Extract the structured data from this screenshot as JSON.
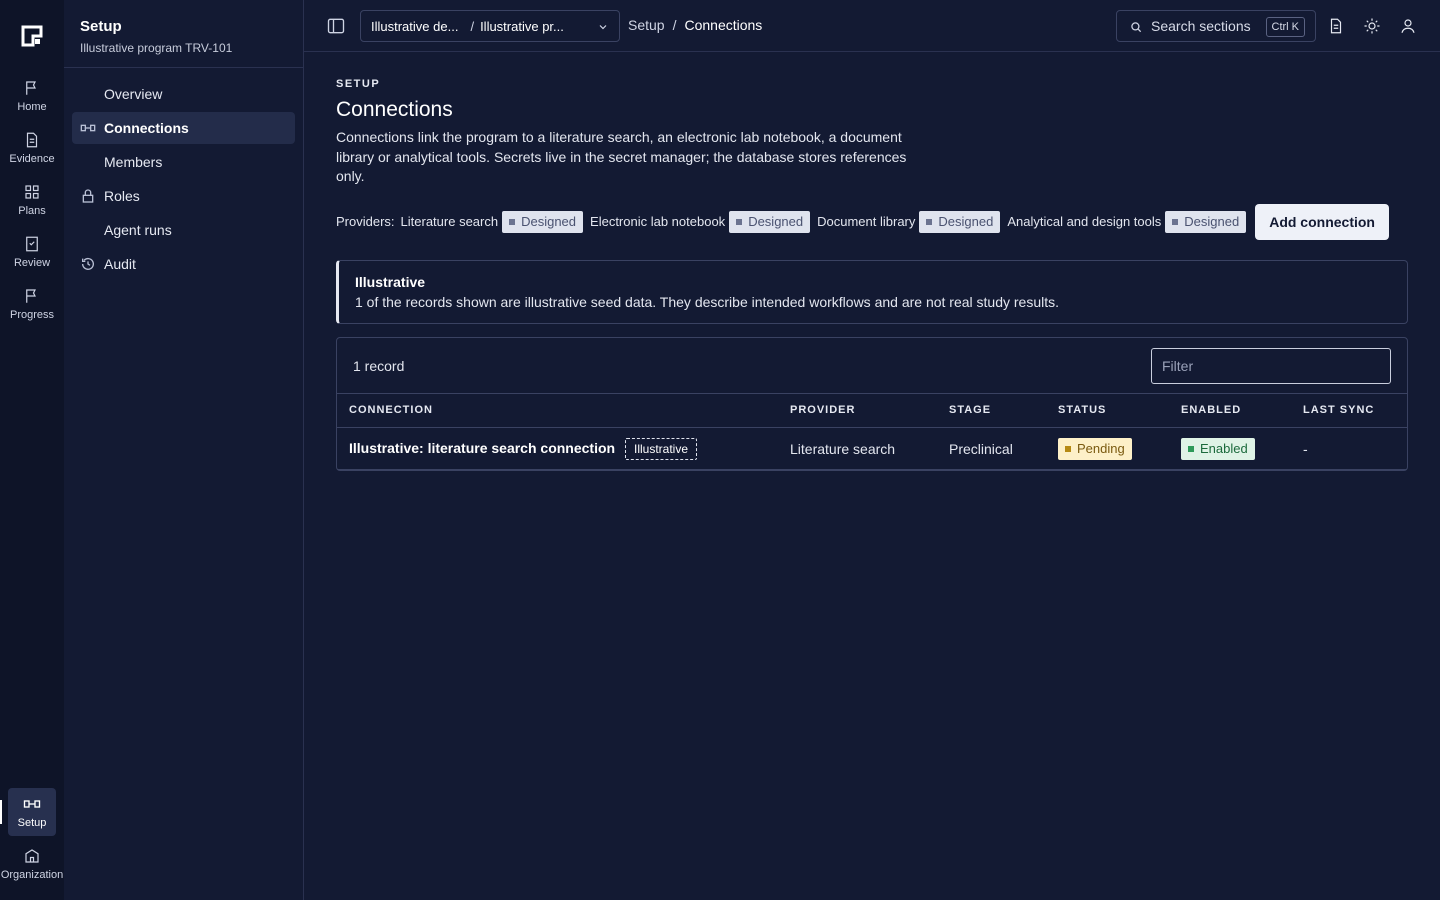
{
  "rail": {
    "items": [
      {
        "label": "Home",
        "icon": "flag-icon"
      },
      {
        "label": "Evidence",
        "icon": "document-icon"
      },
      {
        "label": "Plans",
        "icon": "grid-icon"
      },
      {
        "label": "Review",
        "icon": "checklist-icon"
      },
      {
        "label": "Progress",
        "icon": "flag-icon"
      }
    ],
    "bottom_items": [
      {
        "label": "Setup",
        "icon": "connection-icon",
        "active": true
      },
      {
        "label": "Organization",
        "icon": "building-icon"
      }
    ]
  },
  "subnav": {
    "title": "Setup",
    "subtitle": "Illustrative program TRV-101",
    "items": [
      {
        "label": "Overview"
      },
      {
        "label": "Connections",
        "icon": "connection-icon",
        "active": true
      },
      {
        "label": "Members"
      },
      {
        "label": "Roles",
        "icon": "lock-icon"
      },
      {
        "label": "Agent runs"
      },
      {
        "label": "Audit",
        "icon": "history-icon"
      }
    ]
  },
  "topbar": {
    "context_org": "Illustrative de...",
    "context_sep": "/",
    "context_program": "Illustrative pr...",
    "breadcrumb": {
      "parent": "Setup",
      "sep": "/",
      "current": "Connections"
    },
    "search_placeholder": "Search sections",
    "search_shortcut": "Ctrl K"
  },
  "main": {
    "eyebrow": "SETUP",
    "title": "Connections",
    "description": "Connections link the program to a literature search, an electronic lab notebook, a document library or analytical tools. Secrets live in the secret manager; the database stores references only.",
    "providers_label": "Providers:",
    "providers": [
      {
        "name": "Literature search",
        "status": "Designed"
      },
      {
        "name": "Electronic lab notebook",
        "status": "Designed"
      },
      {
        "name": "Document library",
        "status": "Designed"
      },
      {
        "name": "Analytical and design tools",
        "status": "Designed"
      }
    ],
    "add_button": "Add connection",
    "notice": {
      "title": "Illustrative",
      "body": "1 of the records shown are illustrative seed data. They describe intended workflows and are not real study results."
    },
    "table": {
      "record_count": "1 record",
      "filter_placeholder": "Filter",
      "columns": [
        "CONNECTION",
        "PROVIDER",
        "STAGE",
        "STATUS",
        "ENABLED",
        "LAST SYNC"
      ],
      "rows": [
        {
          "connection": "Illustrative: literature search connection",
          "tag": "Illustrative",
          "provider": "Literature search",
          "stage": "Preclinical",
          "status": "Pending",
          "enabled": "Enabled",
          "last_sync": "-"
        }
      ]
    }
  },
  "colors": {
    "background": "#131a33",
    "rail": "#0e1428",
    "pending_bg": "#fdf0c8",
    "enabled_bg": "#dff3e6",
    "designed_bg": "#dfe3ee"
  }
}
